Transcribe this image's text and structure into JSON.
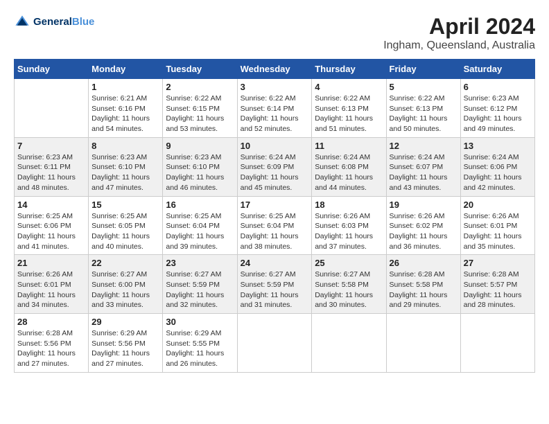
{
  "logo": {
    "text_general": "General",
    "text_blue": "Blue"
  },
  "header": {
    "month": "April 2024",
    "location": "Ingham, Queensland, Australia"
  },
  "weekdays": [
    "Sunday",
    "Monday",
    "Tuesday",
    "Wednesday",
    "Thursday",
    "Friday",
    "Saturday"
  ],
  "weeks": [
    {
      "shaded": false,
      "days": [
        {
          "num": "",
          "info": ""
        },
        {
          "num": "1",
          "info": "Sunrise: 6:21 AM\nSunset: 6:16 PM\nDaylight: 11 hours\nand 54 minutes."
        },
        {
          "num": "2",
          "info": "Sunrise: 6:22 AM\nSunset: 6:15 PM\nDaylight: 11 hours\nand 53 minutes."
        },
        {
          "num": "3",
          "info": "Sunrise: 6:22 AM\nSunset: 6:14 PM\nDaylight: 11 hours\nand 52 minutes."
        },
        {
          "num": "4",
          "info": "Sunrise: 6:22 AM\nSunset: 6:13 PM\nDaylight: 11 hours\nand 51 minutes."
        },
        {
          "num": "5",
          "info": "Sunrise: 6:22 AM\nSunset: 6:13 PM\nDaylight: 11 hours\nand 50 minutes."
        },
        {
          "num": "6",
          "info": "Sunrise: 6:23 AM\nSunset: 6:12 PM\nDaylight: 11 hours\nand 49 minutes."
        }
      ]
    },
    {
      "shaded": true,
      "days": [
        {
          "num": "7",
          "info": "Sunrise: 6:23 AM\nSunset: 6:11 PM\nDaylight: 11 hours\nand 48 minutes."
        },
        {
          "num": "8",
          "info": "Sunrise: 6:23 AM\nSunset: 6:10 PM\nDaylight: 11 hours\nand 47 minutes."
        },
        {
          "num": "9",
          "info": "Sunrise: 6:23 AM\nSunset: 6:10 PM\nDaylight: 11 hours\nand 46 minutes."
        },
        {
          "num": "10",
          "info": "Sunrise: 6:24 AM\nSunset: 6:09 PM\nDaylight: 11 hours\nand 45 minutes."
        },
        {
          "num": "11",
          "info": "Sunrise: 6:24 AM\nSunset: 6:08 PM\nDaylight: 11 hours\nand 44 minutes."
        },
        {
          "num": "12",
          "info": "Sunrise: 6:24 AM\nSunset: 6:07 PM\nDaylight: 11 hours\nand 43 minutes."
        },
        {
          "num": "13",
          "info": "Sunrise: 6:24 AM\nSunset: 6:06 PM\nDaylight: 11 hours\nand 42 minutes."
        }
      ]
    },
    {
      "shaded": false,
      "days": [
        {
          "num": "14",
          "info": "Sunrise: 6:25 AM\nSunset: 6:06 PM\nDaylight: 11 hours\nand 41 minutes."
        },
        {
          "num": "15",
          "info": "Sunrise: 6:25 AM\nSunset: 6:05 PM\nDaylight: 11 hours\nand 40 minutes."
        },
        {
          "num": "16",
          "info": "Sunrise: 6:25 AM\nSunset: 6:04 PM\nDaylight: 11 hours\nand 39 minutes."
        },
        {
          "num": "17",
          "info": "Sunrise: 6:25 AM\nSunset: 6:04 PM\nDaylight: 11 hours\nand 38 minutes."
        },
        {
          "num": "18",
          "info": "Sunrise: 6:26 AM\nSunset: 6:03 PM\nDaylight: 11 hours\nand 37 minutes."
        },
        {
          "num": "19",
          "info": "Sunrise: 6:26 AM\nSunset: 6:02 PM\nDaylight: 11 hours\nand 36 minutes."
        },
        {
          "num": "20",
          "info": "Sunrise: 6:26 AM\nSunset: 6:01 PM\nDaylight: 11 hours\nand 35 minutes."
        }
      ]
    },
    {
      "shaded": true,
      "days": [
        {
          "num": "21",
          "info": "Sunrise: 6:26 AM\nSunset: 6:01 PM\nDaylight: 11 hours\nand 34 minutes."
        },
        {
          "num": "22",
          "info": "Sunrise: 6:27 AM\nSunset: 6:00 PM\nDaylight: 11 hours\nand 33 minutes."
        },
        {
          "num": "23",
          "info": "Sunrise: 6:27 AM\nSunset: 5:59 PM\nDaylight: 11 hours\nand 32 minutes."
        },
        {
          "num": "24",
          "info": "Sunrise: 6:27 AM\nSunset: 5:59 PM\nDaylight: 11 hours\nand 31 minutes."
        },
        {
          "num": "25",
          "info": "Sunrise: 6:27 AM\nSunset: 5:58 PM\nDaylight: 11 hours\nand 30 minutes."
        },
        {
          "num": "26",
          "info": "Sunrise: 6:28 AM\nSunset: 5:58 PM\nDaylight: 11 hours\nand 29 minutes."
        },
        {
          "num": "27",
          "info": "Sunrise: 6:28 AM\nSunset: 5:57 PM\nDaylight: 11 hours\nand 28 minutes."
        }
      ]
    },
    {
      "shaded": false,
      "days": [
        {
          "num": "28",
          "info": "Sunrise: 6:28 AM\nSunset: 5:56 PM\nDaylight: 11 hours\nand 27 minutes."
        },
        {
          "num": "29",
          "info": "Sunrise: 6:29 AM\nSunset: 5:56 PM\nDaylight: 11 hours\nand 27 minutes."
        },
        {
          "num": "30",
          "info": "Sunrise: 6:29 AM\nSunset: 5:55 PM\nDaylight: 11 hours\nand 26 minutes."
        },
        {
          "num": "",
          "info": ""
        },
        {
          "num": "",
          "info": ""
        },
        {
          "num": "",
          "info": ""
        },
        {
          "num": "",
          "info": ""
        }
      ]
    }
  ]
}
